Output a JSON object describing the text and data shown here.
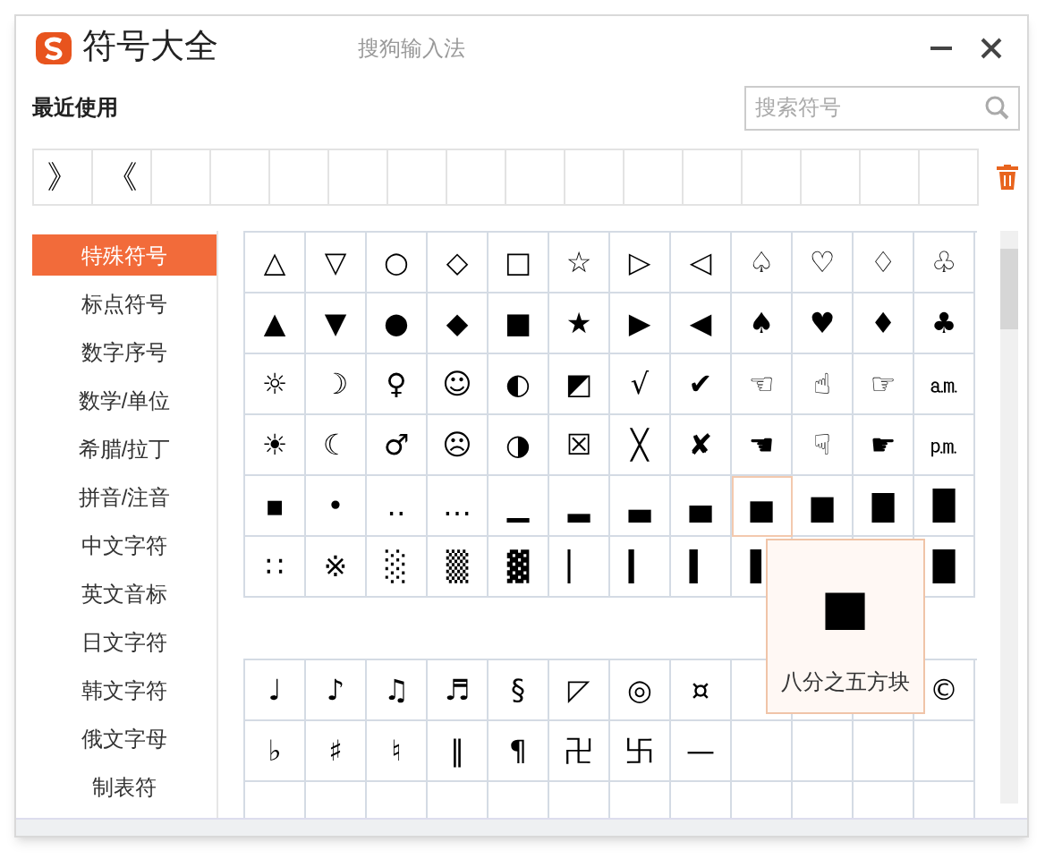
{
  "window": {
    "title": "符号大全",
    "app_name": "搜狗输入法"
  },
  "recent": {
    "label": "最近使用",
    "items": [
      "》",
      "《"
    ]
  },
  "search": {
    "placeholder": "搜索符号"
  },
  "sidebar": {
    "items": [
      {
        "label": "特殊符号",
        "selected": true
      },
      {
        "label": "标点符号",
        "selected": false
      },
      {
        "label": "数字序号",
        "selected": false
      },
      {
        "label": "数学/单位",
        "selected": false
      },
      {
        "label": "希腊/拉丁",
        "selected": false
      },
      {
        "label": "拼音/注音",
        "selected": false
      },
      {
        "label": "中文字符",
        "selected": false
      },
      {
        "label": "英文音标",
        "selected": false
      },
      {
        "label": "日文字符",
        "selected": false
      },
      {
        "label": "韩文字符",
        "selected": false
      },
      {
        "label": "俄文字母",
        "selected": false
      },
      {
        "label": "制表符",
        "selected": false
      }
    ]
  },
  "grids": [
    {
      "rows": [
        [
          "△",
          "▽",
          "○",
          "◇",
          "□",
          "☆",
          "▷",
          "◁",
          "♤",
          "♡",
          "♢",
          "♧"
        ],
        [
          "▲",
          "▼",
          "●",
          "◆",
          "■",
          "★",
          "▶",
          "◀",
          "♠",
          "♥",
          "♦",
          "♣"
        ],
        [
          "☼",
          "☽",
          "♀",
          "☺",
          "◐",
          "◩",
          "√",
          "✔",
          "☜",
          "☝",
          "☞",
          "㏂"
        ],
        [
          "☀",
          "☾",
          "♂",
          "☹",
          "◑",
          "☒",
          "╳",
          "✘",
          "☚",
          "☟",
          "☛",
          "㏘"
        ],
        [
          "▪",
          "•",
          "‥",
          "…",
          "▁",
          "▂",
          "▃",
          "▄",
          {
            "symbol": "▅",
            "hovered": true
          },
          "▆",
          "▇",
          "█"
        ],
        [
          "∷",
          "※",
          "░",
          "▒",
          "▓",
          "▏",
          "▎",
          "▍",
          "▌",
          {
            "kind": "covered"
          },
          {
            "kind": "covered"
          },
          "█"
        ]
      ]
    },
    {
      "rows": [
        [
          "♩",
          "♪",
          "♫",
          "♬",
          "§",
          "◸",
          "◎",
          "¤",
          {
            "kind": "covered"
          },
          {
            "kind": "covered"
          },
          {
            "kind": "covered"
          },
          "©"
        ],
        [
          "♭",
          "♯",
          "♮",
          "‖",
          "¶",
          "卍",
          "卐",
          "—"
        ]
      ]
    }
  ],
  "tooltip": {
    "symbol": "▅",
    "label": "八分之五方块"
  }
}
